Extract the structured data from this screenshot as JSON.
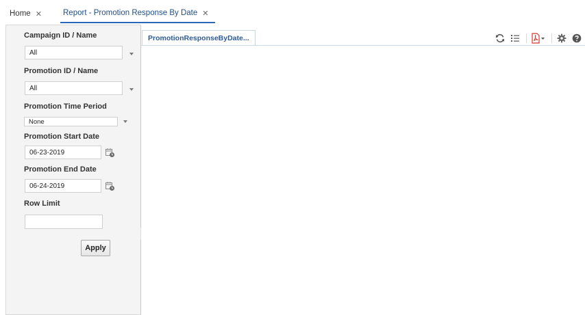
{
  "tabs": [
    {
      "label": "Home",
      "close": "✕"
    },
    {
      "label": "Report - Promotion Response By Date",
      "close": "✕"
    }
  ],
  "parameters": {
    "campaign": {
      "label": "Campaign ID / Name",
      "value": "All"
    },
    "promotion": {
      "label": "Promotion ID / Name",
      "value": "All"
    },
    "time_period": {
      "label": "Promotion Time Period",
      "value": "None"
    },
    "start_date": {
      "label": "Promotion Start Date",
      "value": "06-23-2019"
    },
    "end_date": {
      "label": "Promotion End Date",
      "value": "06-24-2019"
    },
    "row_limit": {
      "label": "Row Limit",
      "value": ""
    },
    "apply_label": "Apply"
  },
  "report": {
    "tab_label": "PromotionResponseByDate..."
  },
  "toolbar": {
    "icons": [
      "refresh-icon",
      "list-icon",
      "pdf-export-icon",
      "settings-icon",
      "help-icon"
    ]
  },
  "colors": {
    "accent": "#2a66b6",
    "panel_bg": "#f4f4f4",
    "pdf_red": "#d9352b"
  }
}
